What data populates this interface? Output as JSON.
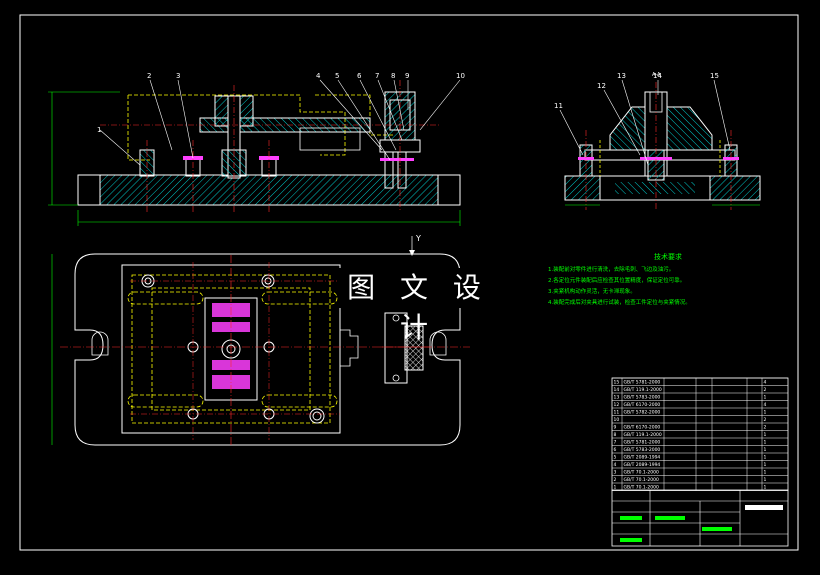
{
  "overlay": {
    "title": "图 文 设 计"
  },
  "section_label": "A-A",
  "view_mark": "Y",
  "part_numbers_front": [
    "1",
    "2",
    "3",
    "4",
    "5",
    "6",
    "7",
    "8",
    "9",
    "10"
  ],
  "part_numbers_section": [
    "11",
    "12",
    "13",
    "14",
    "15"
  ],
  "technical_requirements": {
    "heading": "技术要求",
    "lines": [
      "1.装配前对零件进行清洗，去除毛刺、飞边及油污。",
      "2.各定位元件装配后应检查其位置精度，保证定位可靠。",
      "3.夹紧机构动作灵活，无卡滞现象。",
      "4.装配完成后对夹具进行试装，检查工件定位与夹紧情况。"
    ]
  },
  "parts_table": {
    "rows": [
      [
        "15",
        "GB/T 5781-2000",
        "",
        "",
        "",
        "",
        "4"
      ],
      [
        "14",
        "GB/T 119.1-2000",
        "",
        "",
        "",
        "",
        "2"
      ],
      [
        "13",
        "GB/T 5783-2000",
        "",
        "",
        "",
        "",
        "1"
      ],
      [
        "12",
        "GB/T 6170-2000",
        "",
        "",
        "",
        "",
        "4"
      ],
      [
        "11",
        "GB/T 5782-2000",
        "",
        "",
        "",
        "",
        "1"
      ],
      [
        "10",
        "",
        "",
        "",
        "",
        "",
        "2"
      ],
      [
        "9",
        "GB/T 6170-2000",
        "",
        "",
        "",
        "",
        "2"
      ],
      [
        "8",
        "GB/T 119.1-2000",
        "",
        "",
        "",
        "",
        "1"
      ],
      [
        "7",
        "GB/T 5781-2000",
        "",
        "",
        "",
        "",
        "1"
      ],
      [
        "6",
        "GB/T 5783-2000",
        "",
        "",
        "",
        "",
        "1"
      ],
      [
        "5",
        "GB/T 2089-1994",
        "",
        "",
        "",
        "",
        "1"
      ],
      [
        "4",
        "GB/T 2089-1994",
        "",
        "",
        "",
        "",
        "1"
      ],
      [
        "3",
        "GB/T 70.1-2000",
        "",
        "",
        "",
        "",
        "1"
      ],
      [
        "2",
        "GB/T 70.1-2000",
        "",
        "",
        "",
        "",
        "1"
      ],
      [
        "1",
        "GB/T 70.1-2000",
        "",
        "",
        "",
        "",
        "1"
      ]
    ]
  },
  "colors": {
    "outline": "#ffffff",
    "frame": "#ffffff",
    "centerline": "#ff2a2a",
    "hidden": "#ffff00",
    "hatch": "#00c8c8",
    "leader": "#ffffff",
    "dimension": "#00ff00",
    "magenta": "#ff40ff",
    "text": "#ffffff"
  }
}
